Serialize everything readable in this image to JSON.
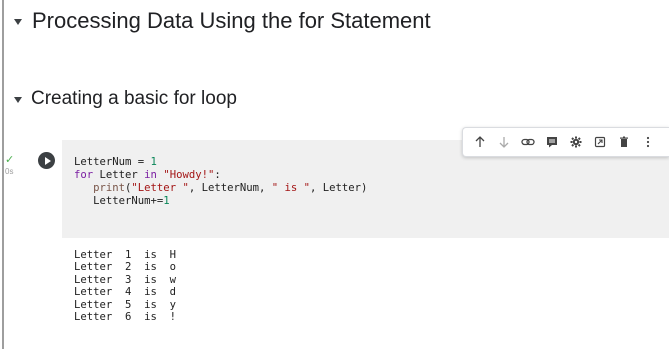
{
  "headings": {
    "section1": "Processing Data Using the for Statement",
    "section2": "Creating a basic for loop"
  },
  "cell": {
    "status_check": "✓",
    "exec_time": "0s",
    "toolbar": [
      "move-up",
      "move-down",
      "link",
      "comment",
      "settings",
      "mirror-cell",
      "delete",
      "more"
    ],
    "code": {
      "l1a": "LetterNum = ",
      "l1b": "1",
      "l2kw": "for",
      "l2a": " Letter ",
      "l2kw2": "in",
      "l2sp": " ",
      "l2str": "\"Howdy!\"",
      "l2c": ":",
      "l3indent": "   ",
      "l3fn": "print",
      "l3a": "(",
      "l3s1": "\"Letter \"",
      "l3b": ", LetterNum, ",
      "l3s2": "\" is \"",
      "l3c": ", Letter)",
      "l4a": "   LetterNum+=",
      "l4b": "1"
    },
    "output": [
      "Letter  1  is  H",
      "Letter  2  is  o",
      "Letter  3  is  w",
      "Letter  4  is  d",
      "Letter  5  is  y",
      "Letter  6  is  !"
    ]
  }
}
